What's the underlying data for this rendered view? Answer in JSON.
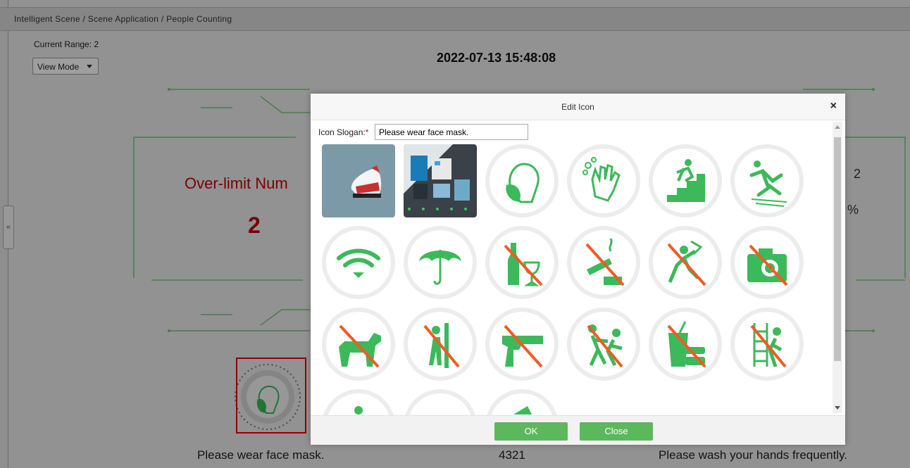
{
  "breadcrumb": "Intelligent Scene / Scene Application / People Counting",
  "current_range": "Current Range: 2",
  "view_mode": "View Mode",
  "datetime": "2022-07-13 15:48:08",
  "over_limit": {
    "label": "Over-limit Num",
    "value": "2"
  },
  "right_partial": {
    "line1": "2",
    "line2": "%"
  },
  "bottom": {
    "left_text": "Please wear face mask.",
    "mid_text": "4321",
    "right_text": "Please wash your hands frequently."
  },
  "modal": {
    "title": "Edit Icon",
    "close_glyph": "×",
    "slogan_label": "Icon Slogan:",
    "slogan_required": "*",
    "slogan_value": "Please wear face mask.",
    "ok_label": "OK",
    "close_label": "Close",
    "icons": [
      "sneaker-photo",
      "building-photo",
      "face-mask-icon",
      "hand-wash-icon",
      "stairs-caution-icon",
      "slip-warning-icon",
      "wifi-icon",
      "umbrella-icon",
      "no-alcohol-icon",
      "no-smoking-icon",
      "no-climbing-icon",
      "no-photography-icon",
      "no-dogs-icon",
      "no-leaning-icon",
      "no-guns-icon",
      "no-pushing-icon",
      "no-food-icon",
      "no-ladder-icon"
    ]
  },
  "colors": {
    "icon_green": "#3cb95a",
    "prohibit_orange": "#f25a25",
    "button_green": "#5cb85c",
    "over_limit_red": "#c00000"
  }
}
